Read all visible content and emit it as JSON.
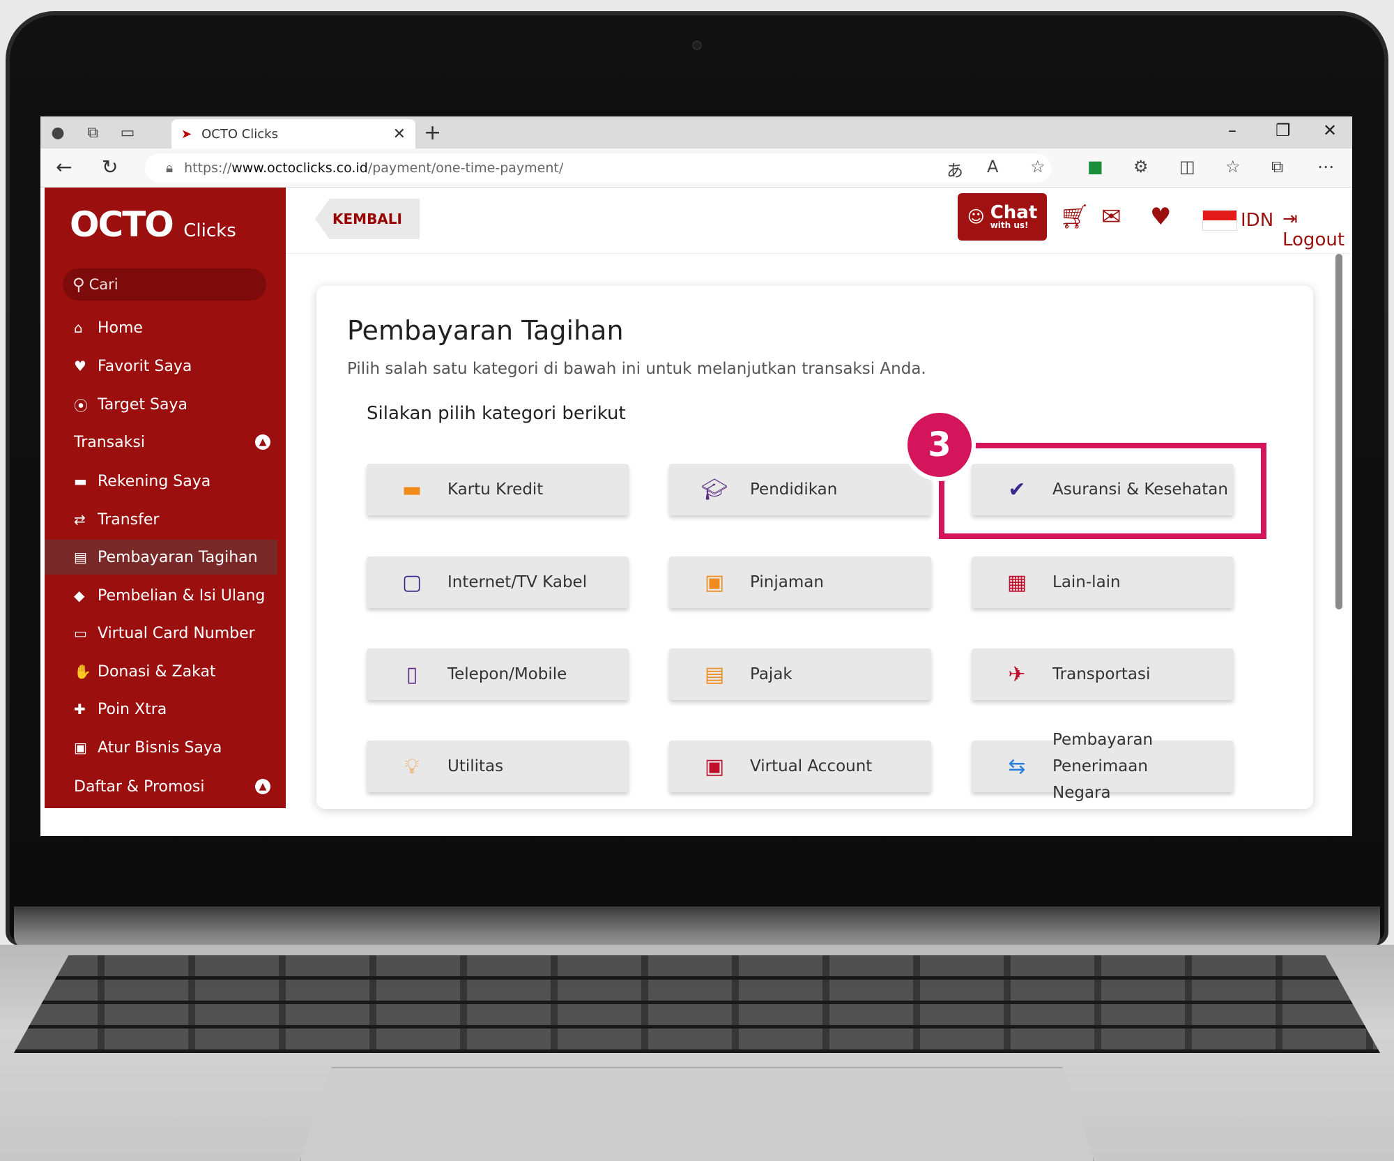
{
  "browser": {
    "tab_title": "OCTO Clicks",
    "url_prefix": "https://",
    "url_domain": "www.octoclicks.co.id",
    "url_path": "/payment/one-time-payment/"
  },
  "sidebar": {
    "logo_main": "OCTO",
    "logo_sub": "Clicks",
    "search_placeholder": "Cari",
    "items": [
      {
        "label": "Home",
        "icon": "home-icon"
      },
      {
        "label": "Favorit Saya",
        "icon": "heart-icon"
      },
      {
        "label": "Target Saya",
        "icon": "location-pin-icon"
      },
      {
        "label": "Transaksi",
        "icon": ""
      },
      {
        "label": "Rekening Saya",
        "icon": "account-card-icon"
      },
      {
        "label": "Transfer",
        "icon": "transfer-icon"
      },
      {
        "label": "Pembayaran Tagihan",
        "icon": "bill-icon"
      },
      {
        "label": "Pembelian & Isi Ulang",
        "icon": "tag-icon"
      },
      {
        "label": "Virtual Card Number",
        "icon": "virtual-card-icon"
      },
      {
        "label": "Donasi & Zakat",
        "icon": "donation-icon"
      },
      {
        "label": "Poin Xtra",
        "icon": "gift-icon"
      },
      {
        "label": "Atur Bisnis Saya",
        "icon": "briefcase-icon"
      },
      {
        "label": "Daftar & Promosi",
        "icon": ""
      }
    ]
  },
  "topbar": {
    "back_label": "KEMBALI",
    "chat_label": "Chat",
    "chat_sub": "with us!",
    "language": "IDN",
    "logout_label": "Logout"
  },
  "content": {
    "title": "Pembayaran Tagihan",
    "subtitle": "Pilih salah satu kategori di bawah ini untuk melanjutkan transaksi Anda.",
    "prompt": "Silakan pilih kategori berikut",
    "categories": [
      {
        "label": "Kartu Kredit",
        "icon": "credit-card-icon"
      },
      {
        "label": "Pendidikan",
        "icon": "graduation-cap-icon"
      },
      {
        "label": "Asuransi & Kesehatan",
        "icon": "shield-check-icon"
      },
      {
        "label": "Internet/TV Kabel",
        "icon": "monitor-icon"
      },
      {
        "label": "Pinjaman",
        "icon": "briefcase-icon"
      },
      {
        "label": "Lain-lain",
        "icon": "grid-icon"
      },
      {
        "label": "Telepon/Mobile",
        "icon": "mobile-phone-icon"
      },
      {
        "label": "Pajak",
        "icon": "clipboard-icon"
      },
      {
        "label": "Transportasi",
        "icon": "airplane-icon"
      },
      {
        "label": "Utilitas",
        "icon": "bulb-drop-icon"
      },
      {
        "label": "Virtual Account",
        "icon": "wallet-icon"
      },
      {
        "label": "Pembayaran Penerimaan Negara",
        "icon": "exchange-icon"
      }
    ],
    "highlight_step": "3"
  },
  "colors": {
    "brand_red": "#9b0f0f",
    "highlight": "#d5155b"
  }
}
